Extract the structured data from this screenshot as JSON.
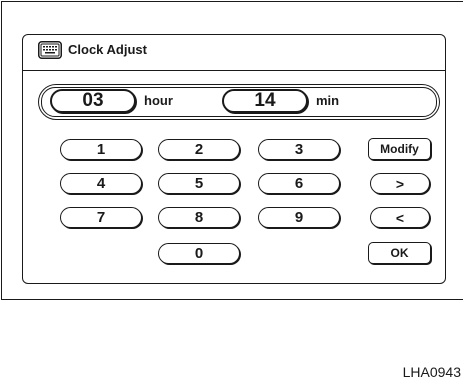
{
  "window": {
    "title": "Clock Adjust",
    "icon": "keyboard-icon"
  },
  "time_display": {
    "hour_value": "03",
    "hour_label": "hour",
    "minute_value": "14",
    "minute_label": "min"
  },
  "keypad": {
    "keys": [
      "1",
      "2",
      "3",
      "4",
      "5",
      "6",
      "7",
      "8",
      "9",
      "0"
    ]
  },
  "controls": {
    "modify_label": "Modify",
    "forward_label": ">",
    "back_label": "<",
    "ok_label": "OK"
  },
  "figure_code": "LHA0943",
  "colors": {
    "ink": "#1a1a1a",
    "background": "#ffffff"
  }
}
